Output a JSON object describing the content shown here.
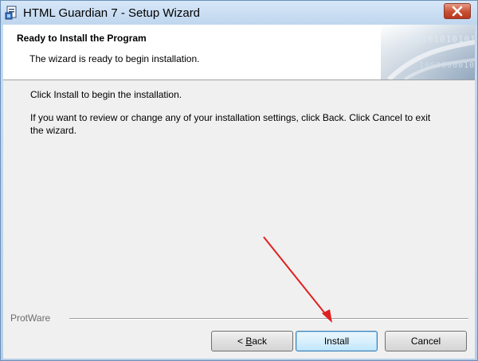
{
  "window": {
    "title": "HTML Guardian 7 - Setup Wizard"
  },
  "header": {
    "title": "Ready to Install the Program",
    "subtitle": "The wizard is ready to begin installation."
  },
  "body": {
    "line1": "Click Install to begin the installation.",
    "line2": "If you want to review or change any of your installation settings, click Back. Click Cancel to exit the wizard."
  },
  "footer": {
    "brand": "ProtWare"
  },
  "buttons": {
    "back_prefix": "< ",
    "back_mnemonic": "B",
    "back_rest": "ack",
    "install": "Install",
    "cancel": "Cancel"
  },
  "banner": {
    "binary_top": "1010101010101",
    "binary_bottom": "10000000100"
  },
  "colors": {
    "annotation_arrow": "#e02020",
    "default_button_border": "#3c7fb1"
  },
  "icons": {
    "app": "installer-icon",
    "close": "close-icon"
  }
}
